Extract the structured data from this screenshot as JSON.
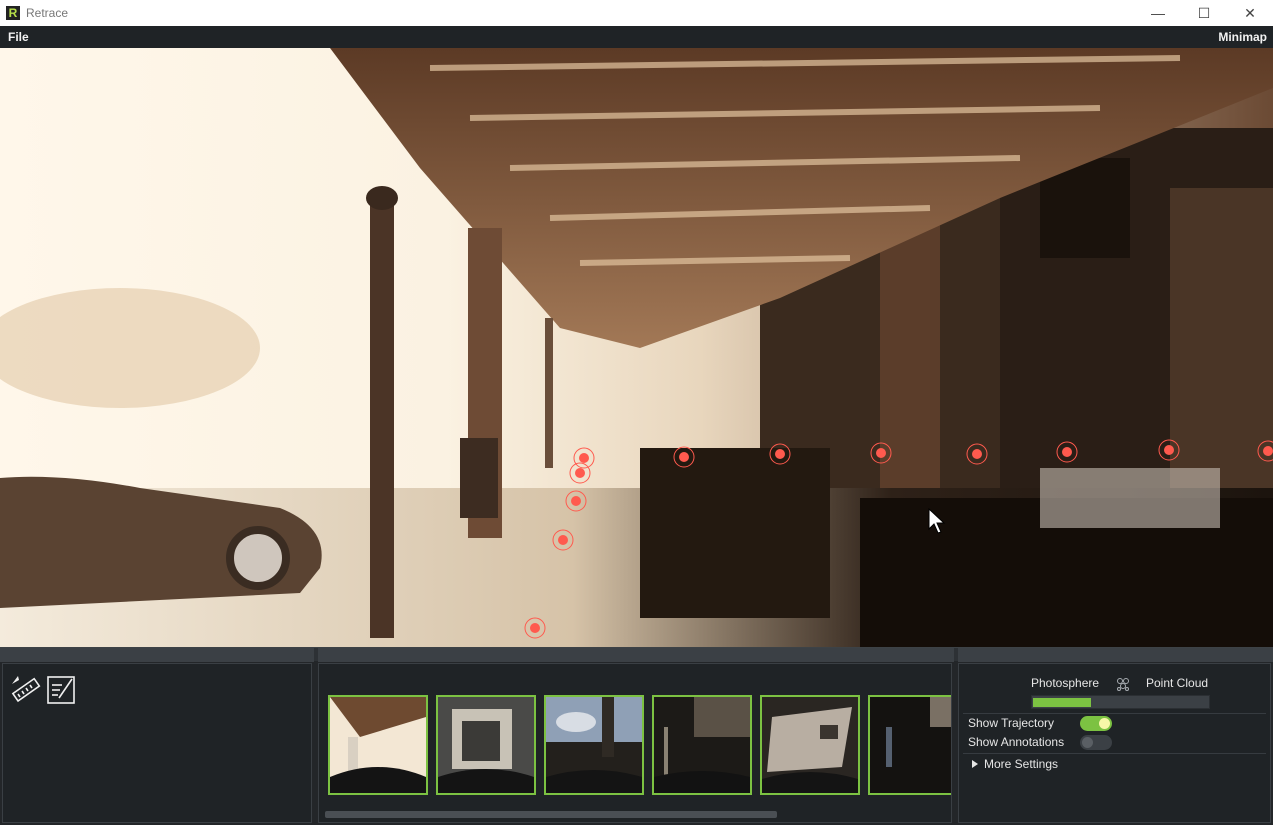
{
  "window": {
    "logo_letter": "R",
    "title": "Retrace",
    "minimize_glyph": "—",
    "maximize_glyph": "☐",
    "close_glyph": "✕"
  },
  "menubar": {
    "file_label": "File",
    "minimap_label": "Minimap"
  },
  "viewport": {
    "content": "photosphere street view of covered porch",
    "trajectory_marker_color": "#ff5a4e"
  },
  "tools": [
    {
      "name": "ruler-icon"
    },
    {
      "name": "notes-icon"
    }
  ],
  "thumbnails": {
    "count_visible": 6,
    "border_color": "#7cc242"
  },
  "settings": {
    "mode_left_label": "Photosphere",
    "mode_right_label": "Point Cloud",
    "mode_slider_value": 0.33,
    "show_trajectory_label": "Show Trajectory",
    "show_trajectory_on": true,
    "show_annotations_label": "Show Annotations",
    "show_annotations_on": false,
    "more_settings_label": "More Settings",
    "accent_color": "#7cc242"
  }
}
